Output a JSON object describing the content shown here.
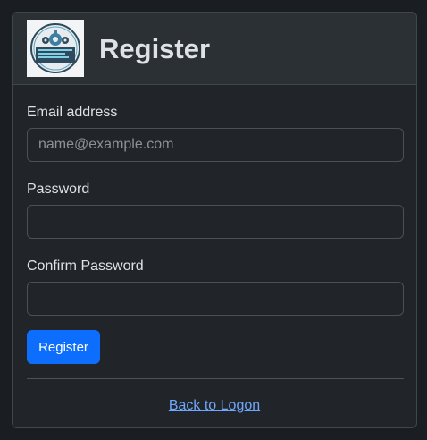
{
  "header": {
    "logo_icon": "gear-card-logo-icon",
    "title": "Register"
  },
  "form": {
    "email": {
      "label": "Email address",
      "placeholder": "name@example.com",
      "value": ""
    },
    "password": {
      "label": "Password",
      "placeholder": "",
      "value": ""
    },
    "confirm_password": {
      "label": "Confirm Password",
      "placeholder": "",
      "value": ""
    },
    "submit_label": "Register"
  },
  "footer": {
    "link_text": "Back to Logon"
  },
  "colors": {
    "accent": "#0d6efd",
    "link": "#6ea8fe",
    "background": "#212529",
    "header_background": "#2b3035",
    "text": "#dee2e6"
  }
}
